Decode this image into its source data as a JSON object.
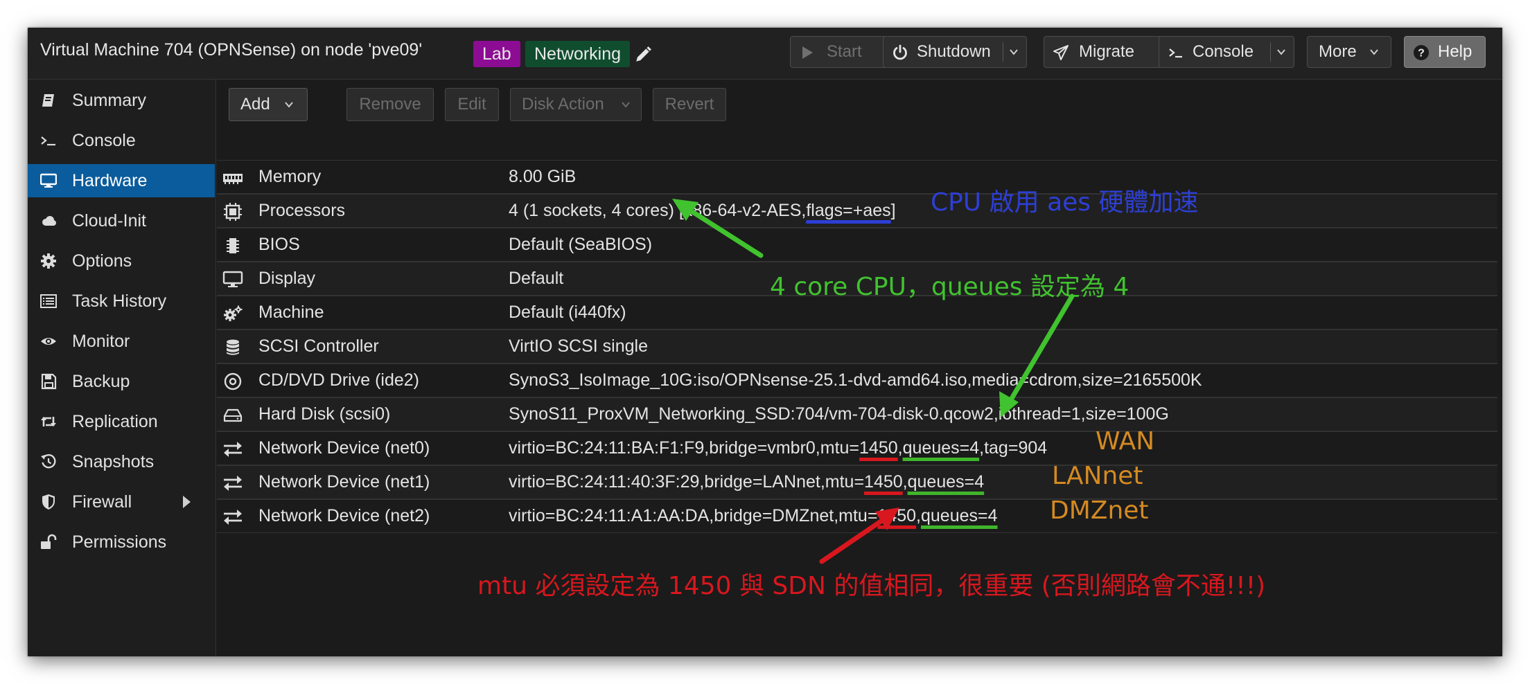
{
  "header": {
    "title": "Virtual Machine 704 (OPNSense) on node 'pve09'",
    "tags": [
      "Lab",
      "Networking"
    ],
    "buttons": {
      "start": "Start",
      "shutdown": "Shutdown",
      "migrate": "Migrate",
      "console": "Console",
      "more": "More",
      "help": "Help"
    }
  },
  "sidebar": {
    "items": [
      {
        "label": "Summary",
        "icon": "book-icon"
      },
      {
        "label": "Console",
        "icon": "terminal-icon"
      },
      {
        "label": "Hardware",
        "icon": "monitor-icon",
        "active": true
      },
      {
        "label": "Cloud-Init",
        "icon": "cloud-icon"
      },
      {
        "label": "Options",
        "icon": "gear-icon"
      },
      {
        "label": "Task History",
        "icon": "list-icon"
      },
      {
        "label": "Monitor",
        "icon": "eye-icon"
      },
      {
        "label": "Backup",
        "icon": "floppy-icon"
      },
      {
        "label": "Replication",
        "icon": "retweet-icon"
      },
      {
        "label": "Snapshots",
        "icon": "history-icon"
      },
      {
        "label": "Firewall",
        "icon": "shield-icon"
      },
      {
        "label": "Permissions",
        "icon": "unlock-icon"
      }
    ]
  },
  "toolbar": {
    "add": "Add",
    "remove": "Remove",
    "edit": "Edit",
    "disk_action": "Disk Action",
    "revert": "Revert"
  },
  "hardware": {
    "memory": {
      "key": "Memory",
      "value": "8.00 GiB",
      "icon": "memory-icon"
    },
    "processors": {
      "key": "Processors",
      "value_a": "4 (1 sockets, 4 cores) [x86-64-v2-AES,",
      "value_b": "flags=+aes",
      "value_c": "]",
      "icon": "cpu-icon"
    },
    "bios": {
      "key": "BIOS",
      "value": "Default (SeaBIOS)",
      "icon": "bios-chip-icon"
    },
    "display": {
      "key": "Display",
      "value": "Default",
      "icon": "desktop-icon"
    },
    "machine": {
      "key": "Machine",
      "value": "Default (i440fx)",
      "icon": "cogs-icon"
    },
    "scsi": {
      "key": "SCSI Controller",
      "value": "VirtIO SCSI single",
      "icon": "database-icon"
    },
    "cdrom": {
      "key": "CD/DVD Drive (ide2)",
      "value": "SynoS3_IsoImage_10G:iso/OPNsense-25.1-dvd-amd64.iso,media=cdrom,size=2165500K",
      "icon": "cdrom-icon"
    },
    "disk": {
      "key": "Hard Disk (scsi0)",
      "value": "SynoS11_ProxVM_Networking_SSD:704/vm-704-disk-0.qcow2,iothread=1,size=100G",
      "icon": "hdd-icon"
    },
    "net0": {
      "key": "Network Device (net0)",
      "value_a": "virtio=BC:24:11:BA:F1:F9,bridge=vmbr0,mtu=",
      "mtu": "1450",
      "comma": ",",
      "queues": "queues=4",
      "value_c": ",tag=904",
      "icon": "exchange-icon"
    },
    "net1": {
      "key": "Network Device (net1)",
      "value_a": "virtio=BC:24:11:40:3F:29,bridge=LANnet,mtu=",
      "mtu": "1450",
      "comma": ",",
      "queues": "queues=4",
      "icon": "exchange-icon"
    },
    "net2": {
      "key": "Network Device (net2)",
      "value_a": "virtio=BC:24:11:A1:AA:DA,bridge=DMZnet,mtu=",
      "mtu": "1450",
      "comma": ",",
      "queues": "queues=4",
      "icon": "exchange-icon"
    }
  },
  "annotations": {
    "cpu": "CPU 啟用 aes 硬體加速",
    "queues": "4 core CPU，queues 設定為 4",
    "wan": "WAN",
    "lannet": "LANnet",
    "dmznet": "DMZnet",
    "mtu": "mtu 必須設定為 1450 與 SDN 的值相同，很重要 (否則網路會不通!!!)"
  },
  "colors": {
    "active_nav": "#0b5c9c",
    "tag_lab": "#8c0c94",
    "tag_networking": "#104d2e",
    "annotation_blue": "#2d3fd4",
    "annotation_green": "#41c22f",
    "annotation_orange": "#d48a22",
    "annotation_red": "#d8171e"
  }
}
